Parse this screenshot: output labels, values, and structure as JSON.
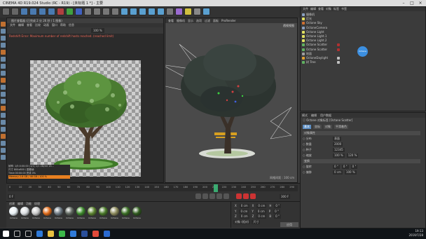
{
  "window": {
    "title": "CINEMA 4D R19.024 Studio (RC - R19) - [未标题 1 *] - 主要"
  },
  "toolbar": {
    "icons": [
      "undo-icon",
      "redo-icon",
      "select-icon",
      "move-icon",
      "scale-icon",
      "rotate-icon",
      "x-axis-icon",
      "y-axis-icon",
      "z-axis-icon",
      "coord-icon",
      "render-view-icon",
      "render-pv-icon",
      "render-settings-icon",
      "cube-icon",
      "spline-icon",
      "nurbs-icon",
      "array-icon",
      "scene-icon",
      "camera-icon",
      "deformer-icon",
      "light-icon",
      "floor-icon",
      "sky-icon"
    ]
  },
  "picture_viewer": {
    "title": "图片查看器 (已完成 2 分 26 秒 / 1 图像)",
    "menu": [
      "文件",
      "编辑",
      "查看",
      "比较",
      "动画",
      "窗口",
      "帮助",
      "信息"
    ],
    "info": "Redshift Error: Maximum number of redshift hosts reached. (reached limit)",
    "stats": [
      "帧率: 1/5:0:00:00 (1/1) 1/1 2D/2D 13...",
      "尺寸 800x800 / 图像帧:",
      "Time:00:00:00 完成 0%",
      "Memory 2.6 GB / 46 GB / 100 %"
    ],
    "zoom": "100 %"
  },
  "viewport": {
    "menu": [
      "查看",
      "摄像机",
      "显示",
      "选项",
      "过滤",
      "面板",
      "ProRender"
    ],
    "camera_label": "透视视图",
    "grid": "网格间距 : 100 cm"
  },
  "object_manager": {
    "menu": [
      "文件",
      "编辑",
      "查看",
      "对象",
      "标签",
      "书签"
    ],
    "objects": [
      "摄像机",
      "灯光",
      "Octane Sky",
      "OctaneCamera",
      "Octane Light",
      "Octane Light.1",
      "Octane Light.2",
      "Octane Scatter",
      "Octane Scatter",
      "地面",
      "OctaneDaylight",
      "树 Tree"
    ],
    "tag_label": "Octane"
  },
  "attributes": {
    "head": [
      "模式",
      "编辑",
      "用户数据"
    ],
    "mode": "ⓘ Octane 对象标签 [Octane Scatter]",
    "tabs": [
      "基本",
      "坐标",
      "对象",
      "平滑着色"
    ],
    "rows": [
      {
        "label": "对象属性",
        "values": []
      },
      {
        "label": "○ 分布",
        "values": [
          "表面"
        ]
      },
      {
        "label": "○ 数量",
        "values": [
          "2000"
        ]
      },
      {
        "label": "○ 种子",
        "values": [
          "12345"
        ]
      },
      {
        "label": "○ 缩放",
        "values": [
          "100 %",
          "120 %"
        ]
      },
      {
        "label": "变换",
        "values": []
      },
      {
        "label": "○ 旋转",
        "values": [
          "0 °",
          "0 °",
          "0 °"
        ]
      },
      {
        "label": "○ 偏移",
        "values": [
          "0 cm",
          "100 %"
        ]
      }
    ]
  },
  "timeline": {
    "ticks": [
      "0",
      "10",
      "20",
      "30",
      "40",
      "50",
      "60",
      "70",
      "80",
      "90",
      "100",
      "110",
      "120",
      "130",
      "140",
      "150",
      "160",
      "170",
      "180",
      "190",
      "200",
      "210",
      "220",
      "230",
      "240",
      "250",
      "260",
      "270",
      "280",
      "290"
    ],
    "current_frame": "0 F",
    "end_frame": "300 F"
  },
  "materials": {
    "menu": [
      "创建",
      "编辑",
      "功能",
      "纹理"
    ],
    "items": [
      {
        "name": "Octane",
        "color": "#e8f0f4"
      },
      {
        "name": "Octane",
        "color": "#d9dde0"
      },
      {
        "name": "Octane",
        "color": "#c8c8c8"
      },
      {
        "name": "Octane",
        "color": "#e06a18"
      },
      {
        "name": "Octane",
        "color": "#6e7a84"
      },
      {
        "name": "Octane",
        "color": "#606860"
      },
      {
        "name": "Octane",
        "color": "#3d8a2c"
      },
      {
        "name": "Octane",
        "color": "#5c8430"
      },
      {
        "name": "Octane",
        "color": "#4b7a2a"
      },
      {
        "name": "Octane",
        "color": "#8c8a5c"
      },
      {
        "name": "Octane",
        "color": "#3a6e24"
      },
      {
        "name": "Octane",
        "color": "#2f5a1e"
      }
    ]
  },
  "coordinates": {
    "rows": [
      [
        "X",
        "0 cm",
        "X",
        "0 cm",
        "H",
        "0 °"
      ],
      [
        "Y",
        "0 cm",
        "Y",
        "0 cm",
        "P",
        "0 °"
      ],
      [
        "Z",
        "0 cm",
        "Z",
        "0 cm",
        "B",
        "0 °"
      ],
      [
        "对象 (相对)",
        "尺寸",
        "应用"
      ]
    ],
    "apply": "应用"
  },
  "taskbar": {
    "time": "19:13",
    "date": "2019/7/28",
    "apps": [
      "windows-start-icon",
      "search-icon",
      "task-view-icon",
      "edge-icon",
      "folder-icon",
      "wechat-icon",
      "store-icon",
      "cinema4d-icon",
      "chrome-icon",
      "photoshop-icon"
    ]
  },
  "colors": {
    "accent": "#3c8fe0",
    "record": "#c33333",
    "orange": "#e88020"
  }
}
